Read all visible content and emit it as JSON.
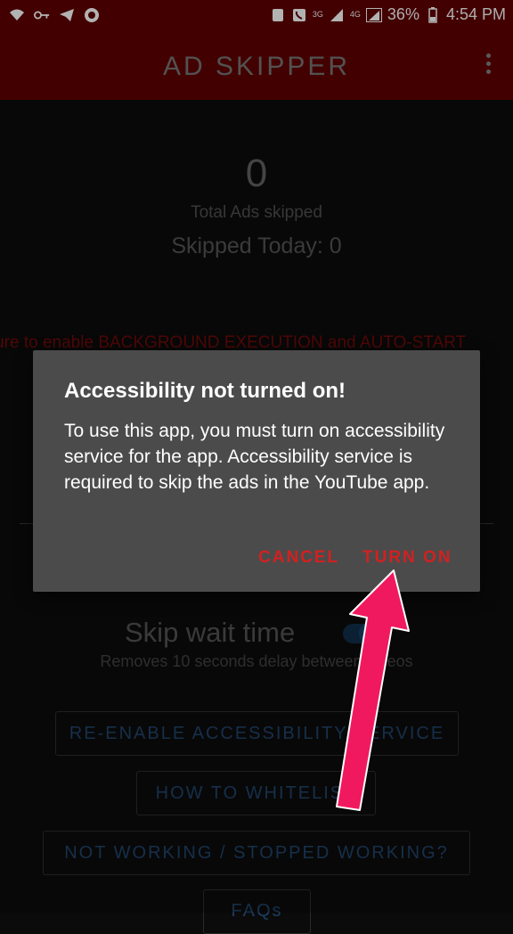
{
  "status_bar": {
    "battery_percent": "36%",
    "time": "4:54 PM",
    "network_3g": "3G",
    "network_4g": "4G"
  },
  "app_bar": {
    "title": "AD SKIPPER"
  },
  "stats": {
    "total_count": "0",
    "total_label": "Total Ads skipped",
    "today": "Skipped Today: 0"
  },
  "warning_text": "Make sure to enable BACKGROUND EXECUTION and AUTO-START",
  "skip_wait": {
    "label": "Skip wait time",
    "description": "Removes 10 seconds delay between videos",
    "enabled": true
  },
  "buttons": {
    "reenable": "RE-ENABLE ACCESSIBILITY SERVICE",
    "whitelist": "HOW TO WHITELIST",
    "not_working": "NOT WORKING / STOPPED WORKING?",
    "faqs": "FAQs"
  },
  "dialog": {
    "title": "Accessibility not turned on!",
    "body": "To use this app, you must turn on accessibility service for the app. Accessibility service is required to skip the ads in the YouTube app.",
    "cancel": "CANCEL",
    "confirm": "TURN ON"
  },
  "colors": {
    "app_bar": "#5a0000",
    "accent_red": "#d32020",
    "arrow": "#f0195f",
    "dialog_bg": "#4b4b4b"
  }
}
